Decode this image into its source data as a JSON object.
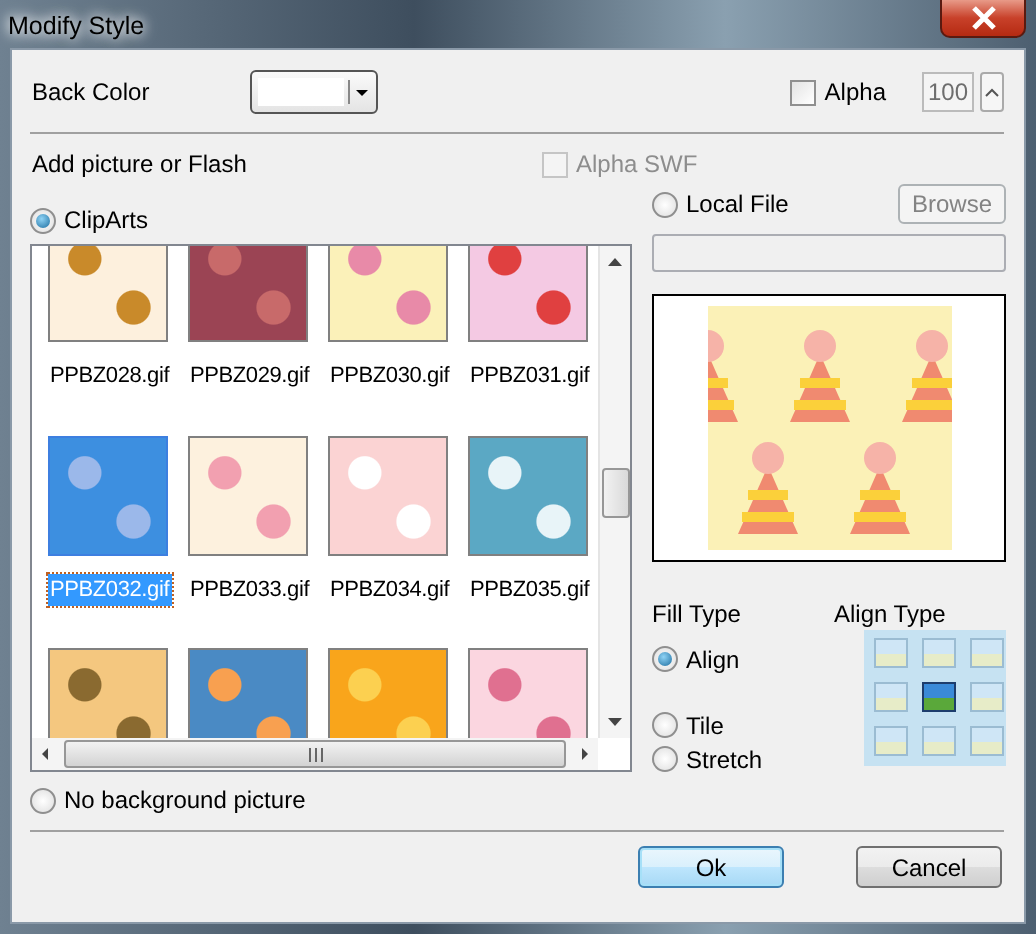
{
  "window": {
    "title": "Modify Style"
  },
  "back_color": {
    "label": "Back Color"
  },
  "alpha": {
    "label": "Alpha",
    "checked": false,
    "value": "100"
  },
  "picture": {
    "label": "Add picture or Flash"
  },
  "alpha_swf": {
    "label": "Alpha SWF",
    "checked": false,
    "disabled": true
  },
  "cliparts": {
    "label": "ClipArts",
    "selected": true
  },
  "clipart_items": [
    {
      "name": "PPBZ028.gif",
      "selected": false
    },
    {
      "name": "PPBZ029.gif",
      "selected": false
    },
    {
      "name": "PPBZ030.gif",
      "selected": false
    },
    {
      "name": "PPBZ031.gif",
      "selected": false
    },
    {
      "name": "PPBZ032.gif",
      "selected": true
    },
    {
      "name": "PPBZ033.gif",
      "selected": false
    },
    {
      "name": "PPBZ034.gif",
      "selected": false
    },
    {
      "name": "PPBZ035.gif",
      "selected": false
    },
    {
      "selected": false
    },
    {
      "selected": false
    },
    {
      "selected": false
    },
    {
      "selected": false
    }
  ],
  "no_background": {
    "label": "No background picture",
    "selected": false
  },
  "local_file": {
    "label": "Local File",
    "selected": false
  },
  "browse_button": {
    "label": "Browse",
    "disabled": true
  },
  "fill_type": {
    "label": "Fill Type",
    "options": [
      {
        "label": "Align",
        "selected": true
      },
      {
        "label": "Tile",
        "selected": false
      },
      {
        "label": "Stretch",
        "selected": false
      }
    ]
  },
  "align_type": {
    "label": "Align Type",
    "cells": [
      {
        "selected": false
      },
      {
        "selected": false
      },
      {
        "selected": false
      },
      {
        "selected": false
      },
      {
        "selected": true
      },
      {
        "selected": false
      },
      {
        "selected": false
      },
      {
        "selected": false
      },
      {
        "selected": false
      }
    ]
  },
  "buttons": [
    {
      "label": "Ok",
      "default": true
    },
    {
      "label": "Cancel",
      "default": false
    }
  ]
}
